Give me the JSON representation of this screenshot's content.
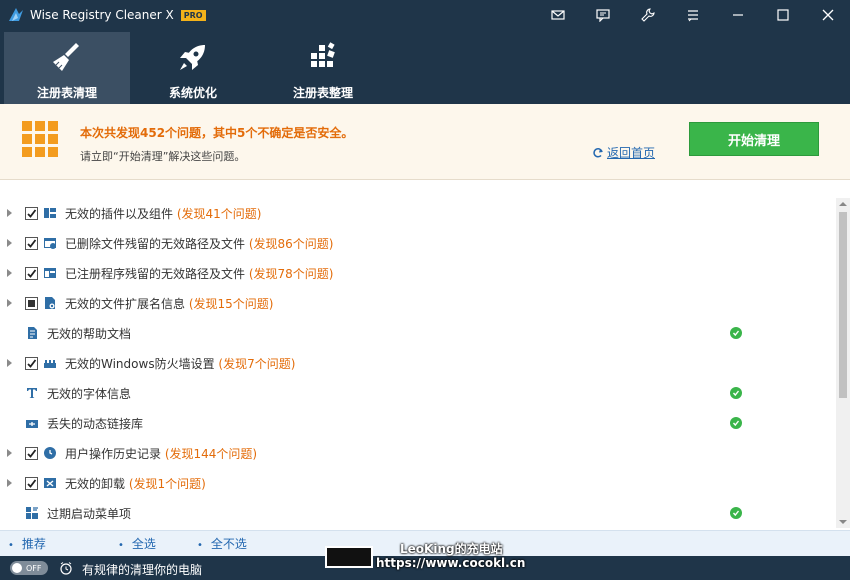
{
  "app": {
    "title": "Wise Registry Cleaner X",
    "badge": "PRO"
  },
  "titlebar_icons": [
    "mail-icon",
    "feedback-icon",
    "tools-icon",
    "menu-icon",
    "minimize-icon",
    "maximize-icon",
    "close-icon"
  ],
  "nav": {
    "tabs": [
      {
        "label": "注册表清理",
        "icon": "broom-icon",
        "active": true
      },
      {
        "label": "系统优化",
        "icon": "rocket-icon",
        "active": false
      },
      {
        "label": "注册表整理",
        "icon": "defrag-icon",
        "active": false
      }
    ]
  },
  "summary": {
    "main": "本次共发现452个问题，其中5个不确定是否安全。",
    "sub": "请立即“开始清理”解决这些问题。",
    "back_home": "返回首页",
    "start_button": "开始清理"
  },
  "items": [
    {
      "label": "无效的插件以及组件",
      "found": "(发现41个问题)",
      "expandable": true,
      "check": "checked",
      "icon": "plugin-icon"
    },
    {
      "label": "已删除文件残留的无效路径及文件",
      "found": "(发现86个问题)",
      "expandable": true,
      "check": "checked",
      "icon": "deleted-file-icon"
    },
    {
      "label": "已注册程序残留的无效路径及文件",
      "found": "(发现78个问题)",
      "expandable": true,
      "check": "checked",
      "icon": "program-icon"
    },
    {
      "label": "无效的文件扩展名信息",
      "found": "(发现15个问题)",
      "expandable": true,
      "check": "partial",
      "icon": "file-ext-icon"
    },
    {
      "label": "无效的帮助文档",
      "found": "",
      "expandable": false,
      "check": "none",
      "icon": "help-doc-icon",
      "ok": true
    },
    {
      "label": "无效的Windows防火墙设置",
      "found": "(发现7个问题)",
      "expandable": true,
      "check": "checked",
      "icon": "firewall-icon"
    },
    {
      "label": "无效的字体信息",
      "found": "",
      "expandable": false,
      "check": "none",
      "icon": "font-icon",
      "ok": true
    },
    {
      "label": "丢失的动态链接库",
      "found": "",
      "expandable": false,
      "check": "none",
      "icon": "dll-icon",
      "ok": true
    },
    {
      "label": "用户操作历史记录",
      "found": "(发现144个问题)",
      "expandable": true,
      "check": "checked",
      "icon": "history-icon"
    },
    {
      "label": "无效的卸载",
      "found": "(发现1个问题)",
      "expandable": true,
      "check": "checked",
      "icon": "uninstall-icon"
    },
    {
      "label": "过期启动菜单项",
      "found": "",
      "expandable": false,
      "check": "none",
      "icon": "startmenu-icon",
      "ok": true
    }
  ],
  "selection": {
    "recommend": "推荐",
    "select_all": "全选",
    "select_none": "全不选"
  },
  "status": {
    "toggle": "OFF",
    "text": "有规律的清理你的电脑"
  },
  "watermark": {
    "line1": "LeoKing的充电站",
    "line2": "https://www.cocokl.cn"
  },
  "colors": {
    "titlebar": "#1f3549",
    "accent_orange": "#e36c0a",
    "start_green": "#3ab54a",
    "link_blue": "#2468b0"
  }
}
